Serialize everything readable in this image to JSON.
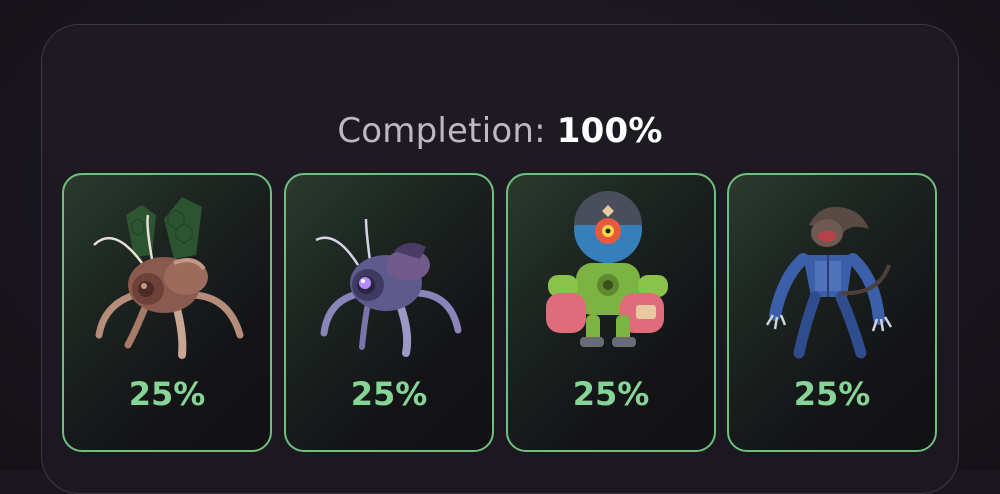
{
  "completion": {
    "label": "Completion:",
    "value": "100%"
  },
  "cards": [
    {
      "creature": "spider-bug-brown",
      "percent": "25%",
      "progress": 0.25
    },
    {
      "creature": "spider-bug-purple",
      "percent": "25%",
      "progress": 0.25
    },
    {
      "creature": "fishbowl-robot-green",
      "percent": "25%",
      "progress": 0.25
    },
    {
      "creature": "werewolf-cyborg-blue",
      "percent": "25%",
      "progress": 0.25
    }
  ],
  "colors": {
    "card_border": "#6fbf7f",
    "percent_text": "#86d596",
    "completion_value": "#ffffff",
    "completion_label": "#bdb8c3"
  }
}
